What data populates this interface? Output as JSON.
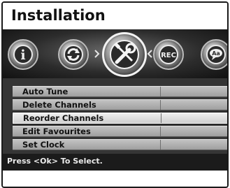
{
  "window": {
    "title": "Installation"
  },
  "iconbar": {
    "icons": [
      {
        "name": "info-icon",
        "glyph": "i"
      },
      {
        "name": "refresh-icon",
        "glyph": ""
      },
      {
        "name": "tools-icon",
        "glyph": ""
      },
      {
        "name": "rec-icon",
        "glyph": "REC"
      },
      {
        "name": "subtitle-icon",
        "glyph": "Aa"
      }
    ],
    "selected_index": 2
  },
  "menu": {
    "items": [
      {
        "label": "Auto Tune"
      },
      {
        "label": "Delete Channels"
      },
      {
        "label": "Reorder Channels"
      },
      {
        "label": "Edit Favourites"
      },
      {
        "label": "Set Clock"
      }
    ],
    "selected_index": 2
  },
  "hint": {
    "text": "Press <Ok> To Select."
  },
  "colors": {
    "panel": "#353535",
    "item": "#b0b0b0",
    "selected": "#e0e0e0",
    "hint_bg": "#1b1b1b"
  }
}
